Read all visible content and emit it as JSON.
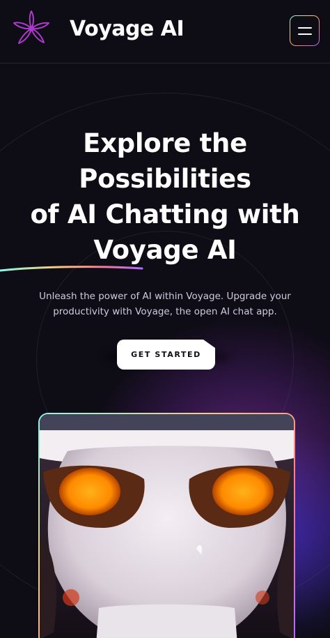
{
  "header": {
    "brand": "Voyage AI",
    "logo_icon": "flower-logo-icon",
    "menu_icon": "hamburger-menu-icon"
  },
  "hero": {
    "title_line1": "Explore the",
    "title_line2": "Possibilities",
    "title_line3": "of AI Chatting with",
    "title_brand": "Voyage AI",
    "subtitle_line1": "Unleash the power of AI within Voyage. Upgrade your",
    "subtitle_line2": "productivity with Voyage, the open AI chat app.",
    "cta_label": "GET STARTED"
  },
  "preview": {
    "image": "robot-face-image"
  },
  "colors": {
    "background": "#0e0c15",
    "accent_gradient": [
      "#89f9e8",
      "#facb7b",
      "#fb7f8f",
      "#ac6aff"
    ],
    "logo": "#ac3acb",
    "cta_bg": "#ffffff"
  }
}
